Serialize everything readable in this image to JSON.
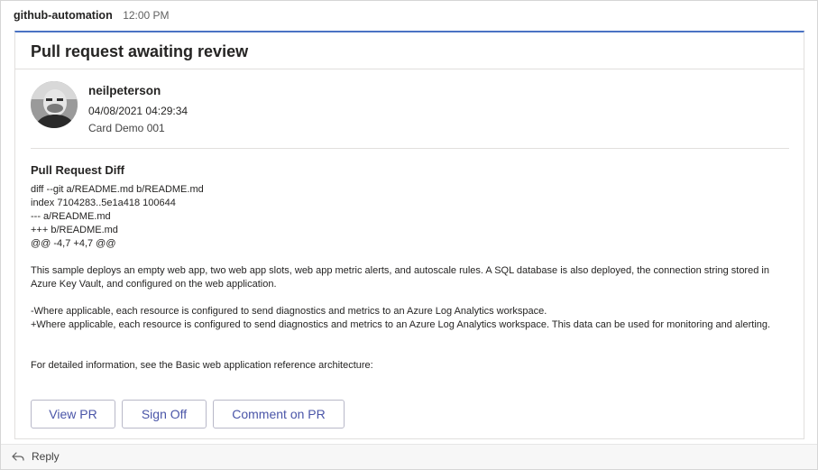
{
  "message": {
    "sender": "github-automation",
    "time": "12:00 PM"
  },
  "card": {
    "title": "Pull request awaiting review",
    "author": "neilpeterson",
    "date": "04/08/2021 04:29:34",
    "subtitle": "Card Demo 001",
    "section_title": "Pull Request Diff",
    "diff_lines": [
      "diff --git a/README.md b/README.md",
      "index 7104283..5e1a418 100644",
      "--- a/README.md",
      "+++ b/README.md",
      "@@ -4,7 +4,7 @@"
    ],
    "paragraphs": [
      "This sample deploys an empty web app, two web app slots, web app metric alerts, and autoscale rules. A SQL database is also deployed, the connection string stored in Azure Key Vault, and configured on the web application.",
      "-Where applicable, each resource is configured to send diagnostics and metrics to an Azure Log Analytics workspace.",
      "+Where applicable, each resource is configured to send diagnostics and metrics to an Azure Log Analytics workspace. This data can be used for monitoring and alerting.",
      "For detailed information, see the Basic web application reference architecture:"
    ],
    "actions": {
      "view_pr": "View PR",
      "sign_off": "Sign Off",
      "comment": "Comment on PR"
    }
  },
  "footer": {
    "reply_label": "Reply"
  },
  "colors": {
    "accent_border": "#4a72c4",
    "button_text": "#4a55a8"
  }
}
